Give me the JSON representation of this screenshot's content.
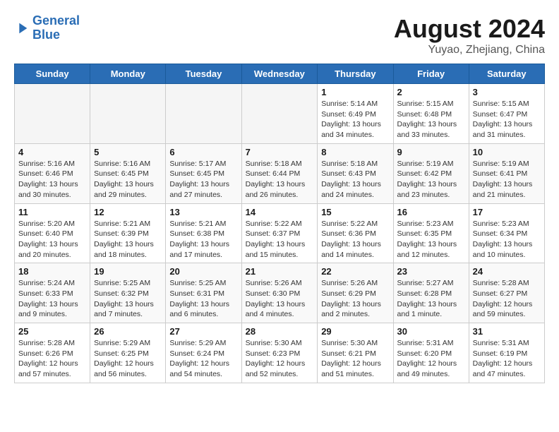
{
  "logo": {
    "line1": "General",
    "line2": "Blue"
  },
  "title": "August 2024",
  "subtitle": "Yuyao, Zhejiang, China",
  "weekdays": [
    "Sunday",
    "Monday",
    "Tuesday",
    "Wednesday",
    "Thursday",
    "Friday",
    "Saturday"
  ],
  "weeks": [
    [
      {
        "day": "",
        "empty": true
      },
      {
        "day": "",
        "empty": true
      },
      {
        "day": "",
        "empty": true
      },
      {
        "day": "",
        "empty": true
      },
      {
        "day": "1",
        "sunrise": "5:14 AM",
        "sunset": "6:49 PM",
        "daylight": "13 hours and 34 minutes."
      },
      {
        "day": "2",
        "sunrise": "5:15 AM",
        "sunset": "6:48 PM",
        "daylight": "13 hours and 33 minutes."
      },
      {
        "day": "3",
        "sunrise": "5:15 AM",
        "sunset": "6:47 PM",
        "daylight": "13 hours and 31 minutes."
      }
    ],
    [
      {
        "day": "4",
        "sunrise": "5:16 AM",
        "sunset": "6:46 PM",
        "daylight": "13 hours and 30 minutes."
      },
      {
        "day": "5",
        "sunrise": "5:16 AM",
        "sunset": "6:45 PM",
        "daylight": "13 hours and 29 minutes."
      },
      {
        "day": "6",
        "sunrise": "5:17 AM",
        "sunset": "6:45 PM",
        "daylight": "13 hours and 27 minutes."
      },
      {
        "day": "7",
        "sunrise": "5:18 AM",
        "sunset": "6:44 PM",
        "daylight": "13 hours and 26 minutes."
      },
      {
        "day": "8",
        "sunrise": "5:18 AM",
        "sunset": "6:43 PM",
        "daylight": "13 hours and 24 minutes."
      },
      {
        "day": "9",
        "sunrise": "5:19 AM",
        "sunset": "6:42 PM",
        "daylight": "13 hours and 23 minutes."
      },
      {
        "day": "10",
        "sunrise": "5:19 AM",
        "sunset": "6:41 PM",
        "daylight": "13 hours and 21 minutes."
      }
    ],
    [
      {
        "day": "11",
        "sunrise": "5:20 AM",
        "sunset": "6:40 PM",
        "daylight": "13 hours and 20 minutes."
      },
      {
        "day": "12",
        "sunrise": "5:21 AM",
        "sunset": "6:39 PM",
        "daylight": "13 hours and 18 minutes."
      },
      {
        "day": "13",
        "sunrise": "5:21 AM",
        "sunset": "6:38 PM",
        "daylight": "13 hours and 17 minutes."
      },
      {
        "day": "14",
        "sunrise": "5:22 AM",
        "sunset": "6:37 PM",
        "daylight": "13 hours and 15 minutes."
      },
      {
        "day": "15",
        "sunrise": "5:22 AM",
        "sunset": "6:36 PM",
        "daylight": "13 hours and 14 minutes."
      },
      {
        "day": "16",
        "sunrise": "5:23 AM",
        "sunset": "6:35 PM",
        "daylight": "13 hours and 12 minutes."
      },
      {
        "day": "17",
        "sunrise": "5:23 AM",
        "sunset": "6:34 PM",
        "daylight": "13 hours and 10 minutes."
      }
    ],
    [
      {
        "day": "18",
        "sunrise": "5:24 AM",
        "sunset": "6:33 PM",
        "daylight": "13 hours and 9 minutes."
      },
      {
        "day": "19",
        "sunrise": "5:25 AM",
        "sunset": "6:32 PM",
        "daylight": "13 hours and 7 minutes."
      },
      {
        "day": "20",
        "sunrise": "5:25 AM",
        "sunset": "6:31 PM",
        "daylight": "13 hours and 6 minutes."
      },
      {
        "day": "21",
        "sunrise": "5:26 AM",
        "sunset": "6:30 PM",
        "daylight": "13 hours and 4 minutes."
      },
      {
        "day": "22",
        "sunrise": "5:26 AM",
        "sunset": "6:29 PM",
        "daylight": "13 hours and 2 minutes."
      },
      {
        "day": "23",
        "sunrise": "5:27 AM",
        "sunset": "6:28 PM",
        "daylight": "13 hours and 1 minute."
      },
      {
        "day": "24",
        "sunrise": "5:28 AM",
        "sunset": "6:27 PM",
        "daylight": "12 hours and 59 minutes."
      }
    ],
    [
      {
        "day": "25",
        "sunrise": "5:28 AM",
        "sunset": "6:26 PM",
        "daylight": "12 hours and 57 minutes."
      },
      {
        "day": "26",
        "sunrise": "5:29 AM",
        "sunset": "6:25 PM",
        "daylight": "12 hours and 56 minutes."
      },
      {
        "day": "27",
        "sunrise": "5:29 AM",
        "sunset": "6:24 PM",
        "daylight": "12 hours and 54 minutes."
      },
      {
        "day": "28",
        "sunrise": "5:30 AM",
        "sunset": "6:23 PM",
        "daylight": "12 hours and 52 minutes."
      },
      {
        "day": "29",
        "sunrise": "5:30 AM",
        "sunset": "6:21 PM",
        "daylight": "12 hours and 51 minutes."
      },
      {
        "day": "30",
        "sunrise": "5:31 AM",
        "sunset": "6:20 PM",
        "daylight": "12 hours and 49 minutes."
      },
      {
        "day": "31",
        "sunrise": "5:31 AM",
        "sunset": "6:19 PM",
        "daylight": "12 hours and 47 minutes."
      }
    ]
  ]
}
